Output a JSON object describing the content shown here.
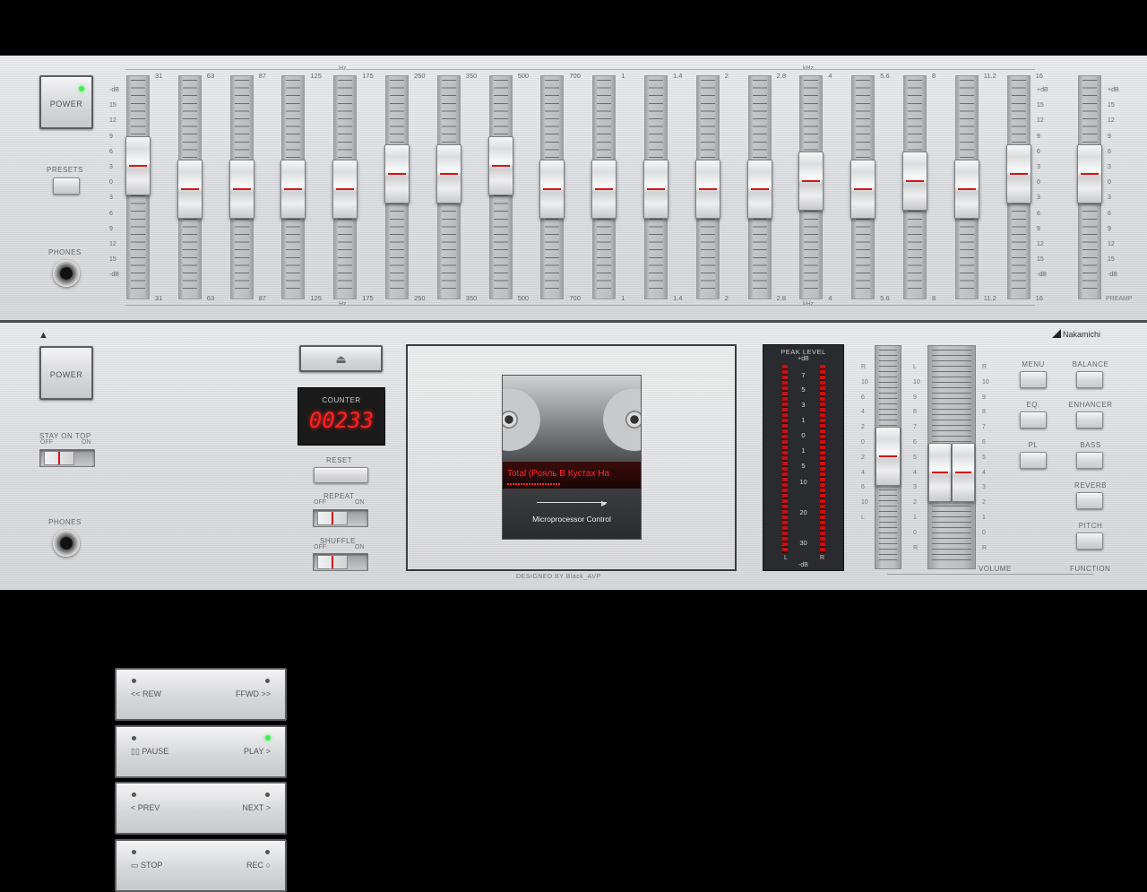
{
  "equalizer": {
    "power_label": "POWER",
    "presets_label": "PRESETS",
    "phones_label": "PHONES",
    "hz_label": "Hz",
    "khz_label": "kHz",
    "preamp_label": "PREAMP",
    "db_scale_left": [
      "-dB",
      "15",
      "12",
      "9",
      "6",
      "3",
      "0",
      "3",
      "6",
      "9",
      "12",
      "15",
      "-dB"
    ],
    "db_scale_right": [
      "+dB",
      "15",
      "12",
      "9",
      "6",
      "3",
      "0",
      "3",
      "6",
      "9",
      "12",
      "15",
      "-dB"
    ],
    "bands": [
      {
        "freq": "31",
        "gain": 3
      },
      {
        "freq": "63",
        "gain": 0
      },
      {
        "freq": "87",
        "gain": 0
      },
      {
        "freq": "125",
        "gain": 0
      },
      {
        "freq": "175",
        "gain": 0
      },
      {
        "freq": "250",
        "gain": 2
      },
      {
        "freq": "350",
        "gain": 2
      },
      {
        "freq": "500",
        "gain": 3
      },
      {
        "freq": "700",
        "gain": 0
      },
      {
        "freq": "1",
        "gain": 0
      },
      {
        "freq": "1.4",
        "gain": 0
      },
      {
        "freq": "2",
        "gain": 0
      },
      {
        "freq": "2.8",
        "gain": 0
      },
      {
        "freq": "4",
        "gain": 1
      },
      {
        "freq": "5.6",
        "gain": 0
      },
      {
        "freq": "8",
        "gain": 1
      },
      {
        "freq": "11.2",
        "gain": 0
      },
      {
        "freq": "16",
        "gain": 2
      }
    ],
    "preamp_gain": 2
  },
  "deck": {
    "power_label": "POWER",
    "stay_on_top_label": "STAY ON TOP",
    "off_label": "OFF",
    "on_label": "ON",
    "phones_label": "PHONES",
    "transport": [
      {
        "left": "<< REW",
        "right": "FFWD >>"
      },
      {
        "left": "▯▯ PAUSE",
        "right": "PLAY >"
      },
      {
        "left": "< PREV",
        "right": "NEXT >"
      },
      {
        "left": "▭ STOP",
        "right": "REC ○"
      }
    ],
    "eject_icon": "eject-icon",
    "counter_label": "COUNTER",
    "counter_value": "00233",
    "reset_label": "RESET",
    "repeat_label": "REPEAT",
    "shuffle_label": "SHUFFLE",
    "track_title": "Total (Рояль В Кустах На",
    "microprocessor_label": "Microprocessor Control",
    "designed_by": "DESIGNED BY Black_AVP",
    "brand": "Nakamichi",
    "peak_level_label": "PEAK LEVEL",
    "meter_top": "+dB",
    "meter_bottom": "-dB",
    "meter_scale": [
      "7",
      "5",
      "3",
      "1",
      "0",
      "1",
      "5",
      "10",
      "20",
      "30"
    ],
    "meter_l": "L",
    "meter_r": "R",
    "balance_scale": [
      "R",
      "10",
      "6",
      "4",
      "2",
      "0",
      "2",
      "4",
      "6",
      "10",
      "L"
    ],
    "volume_scale_left": [
      "L",
      "10",
      "9",
      "8",
      "7",
      "6",
      "5",
      "4",
      "3",
      "2",
      "1",
      "0",
      "R"
    ],
    "volume_scale_right": [
      "R",
      "10",
      "9",
      "8",
      "7",
      "6",
      "5",
      "4",
      "3",
      "2",
      "1",
      "0",
      "R"
    ],
    "volume_label": "VOLUME",
    "function_label": "FUNCTION",
    "func_buttons_left": [
      "MENU",
      "EQ.",
      "PL"
    ],
    "func_buttons_right": [
      "BALANCE",
      "ENHANCER",
      "BASS",
      "REVERB",
      "PITCH"
    ],
    "accent_led": "#3ef14f",
    "accent_red": "#d01818"
  }
}
